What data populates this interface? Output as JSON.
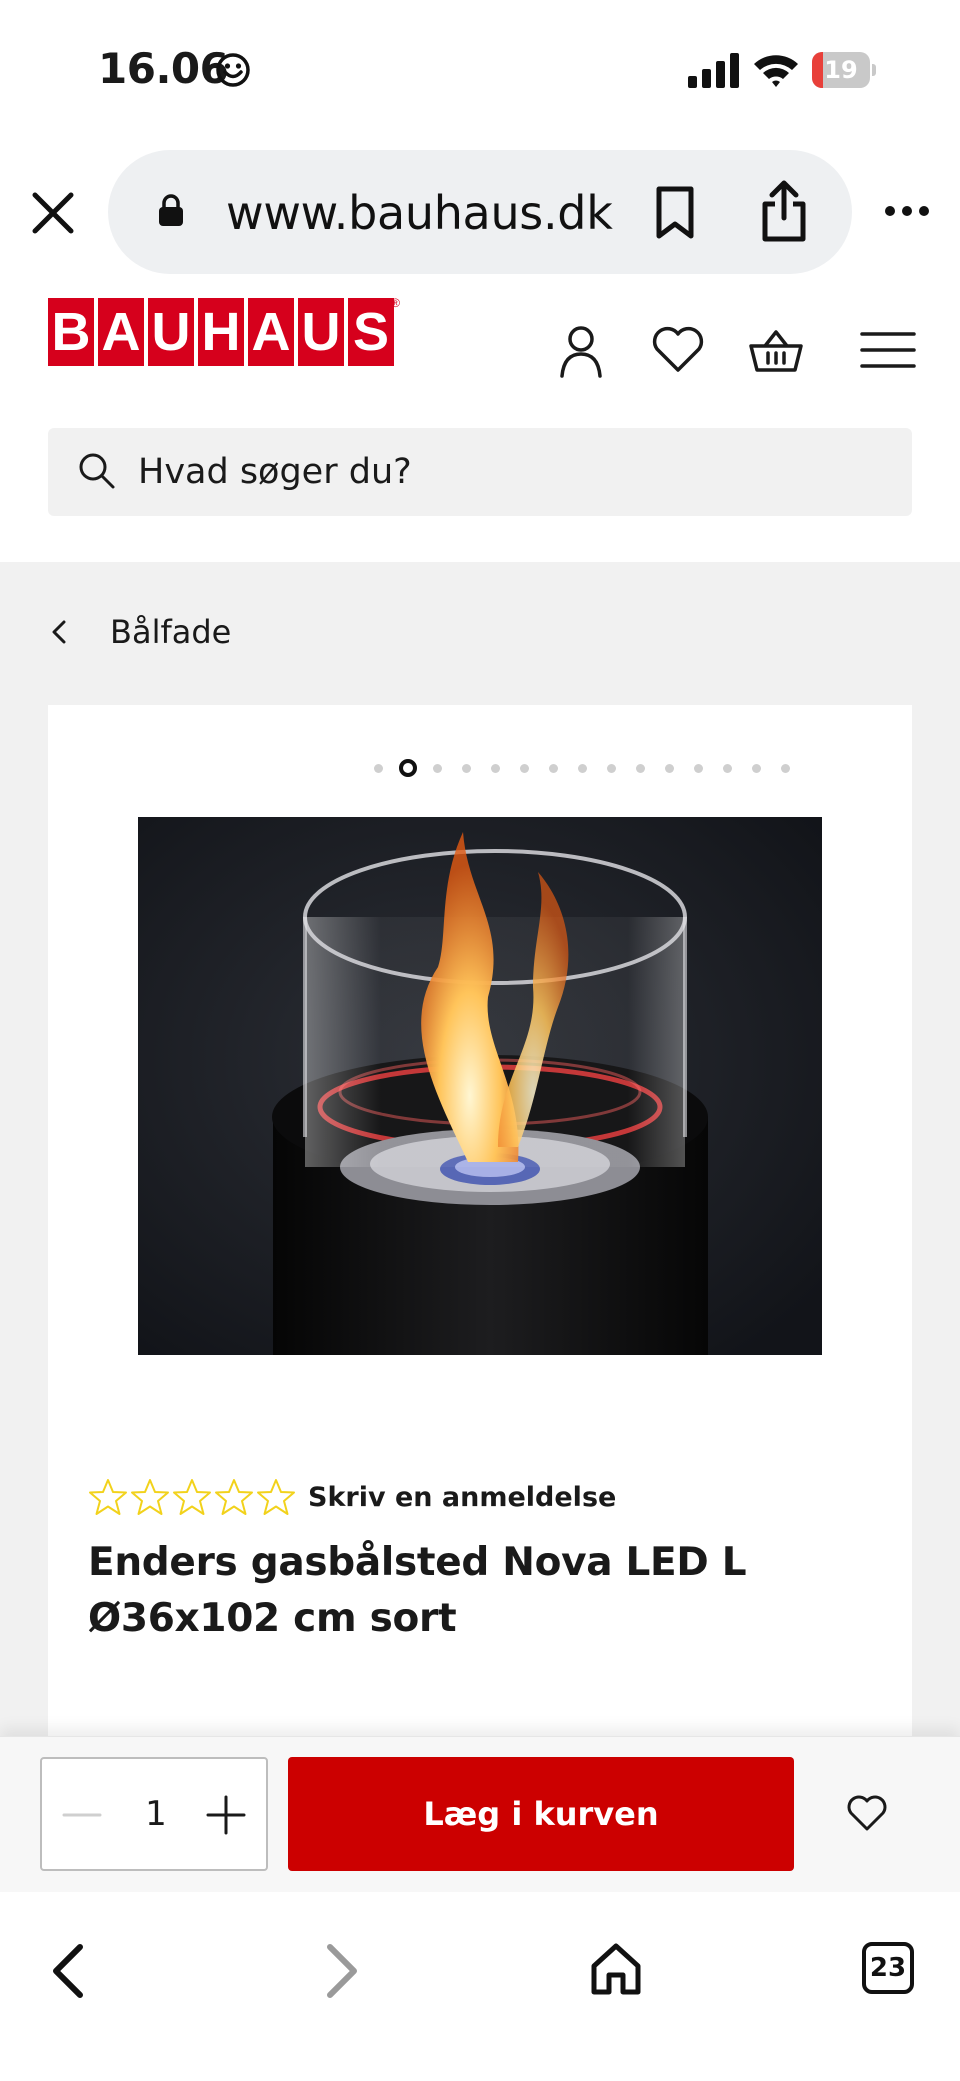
{
  "status_bar": {
    "time": "16.06",
    "battery_level": "19",
    "battery_fraction": 0.19
  },
  "browser": {
    "url": "www.bauhaus.dk",
    "open_tabs": "23",
    "icons": [
      "close-icon",
      "lock-icon",
      "bookmark-icon",
      "share-icon",
      "more-icon",
      "back-arrow-icon",
      "forward-arrow-icon",
      "home-icon",
      "tabs-icon"
    ]
  },
  "header": {
    "logo_letters": [
      "B",
      "A",
      "U",
      "H",
      "A",
      "U",
      "S"
    ],
    "icons": [
      "account-icon",
      "wishlist-heart-icon",
      "basket-icon",
      "hamburger-menu-icon"
    ]
  },
  "search": {
    "placeholder": "Hvad søger du?"
  },
  "breadcrumb": {
    "label": "Bålfade"
  },
  "product": {
    "gallery_total": 15,
    "gallery_active_index": 1,
    "rating_stars": 0,
    "rating_max": 5,
    "review_link": "Skriv en anmeldelse",
    "title": "Enders gasbålsted Nova LED L Ø36x102 cm sort"
  },
  "cart_bar": {
    "quantity": "1",
    "add_to_cart_label": "Læg i kurven"
  },
  "colors": {
    "brand_red": "#d6001c",
    "button_red": "#cc0000",
    "star_yellow": "#f2d21b",
    "page_grey": "#f1f1f1"
  }
}
